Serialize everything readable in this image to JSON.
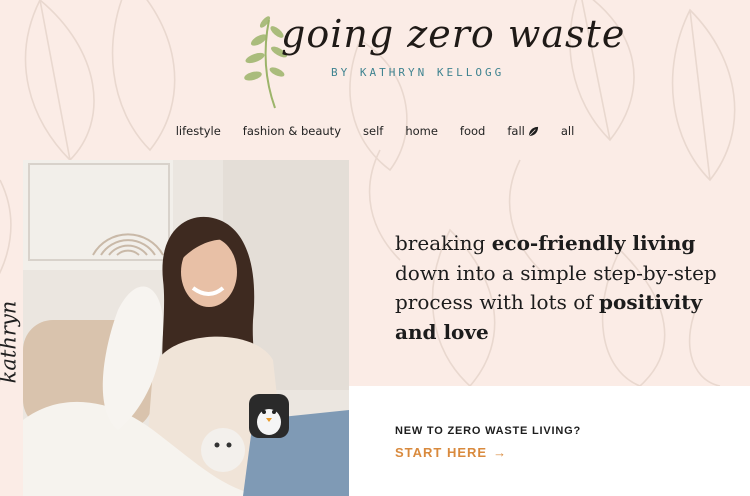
{
  "logo": {
    "wordmark": "going zero waste",
    "byline": "BY KATHRYN KELLOGG"
  },
  "nav": {
    "items": [
      {
        "label": "lifestyle"
      },
      {
        "label": "fashion & beauty"
      },
      {
        "label": "self"
      },
      {
        "label": "home"
      },
      {
        "label": "food"
      },
      {
        "label": "fall",
        "icon": "leaf-icon"
      },
      {
        "label": "all"
      }
    ]
  },
  "hero": {
    "signature": "kathryn",
    "tagline": {
      "part1": "breaking ",
      "bold1": "eco-friendly living",
      "part2": " down into a simple step-by-step process with lots of ",
      "bold2": "positivity and love"
    }
  },
  "cta": {
    "question": "NEW TO ZERO WASTE LIVING?",
    "link_label": "START HERE",
    "arrow": "→"
  },
  "colors": {
    "background": "#fbece6",
    "accent_orange": "#d98a3d",
    "byline_teal": "#3f8390",
    "sprig_green": "#9cb46a"
  }
}
